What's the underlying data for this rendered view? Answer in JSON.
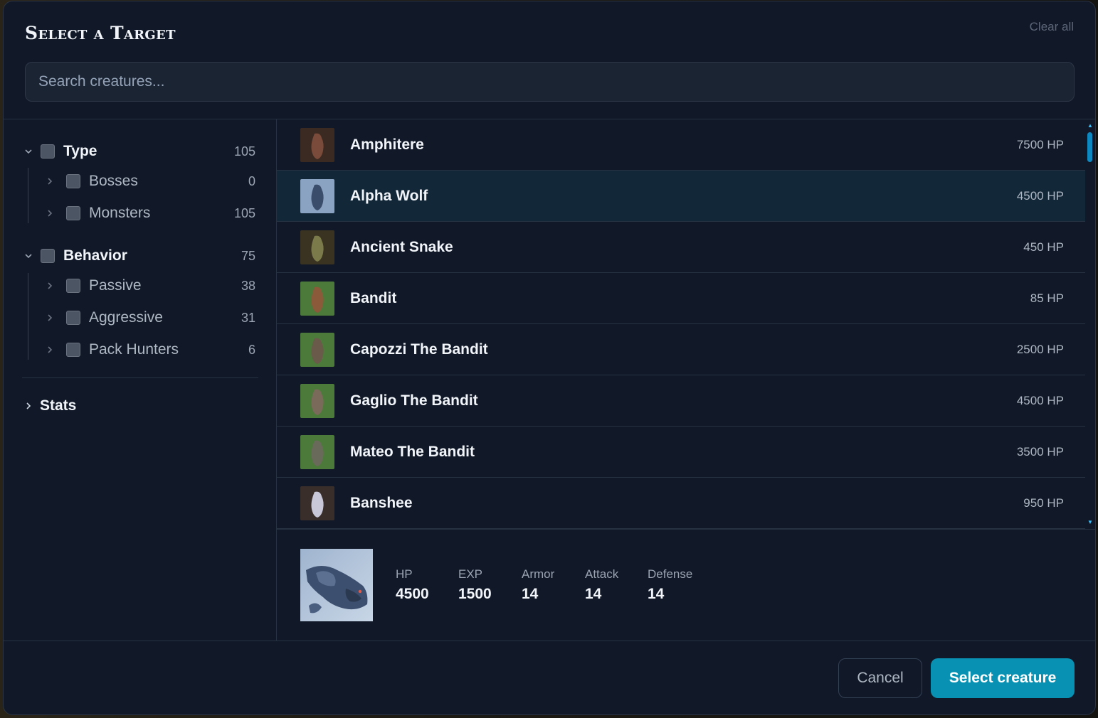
{
  "dialog": {
    "title": "Select a Target",
    "clear_all": "Clear all",
    "search_placeholder": "Search creatures..."
  },
  "filters": {
    "groups": [
      {
        "label": "Type",
        "count": "105",
        "expanded": true,
        "items": [
          {
            "label": "Bosses",
            "count": "0"
          },
          {
            "label": "Monsters",
            "count": "105"
          }
        ]
      },
      {
        "label": "Behavior",
        "count": "75",
        "expanded": true,
        "items": [
          {
            "label": "Passive",
            "count": "38"
          },
          {
            "label": "Aggressive",
            "count": "31"
          },
          {
            "label": "Pack Hunters",
            "count": "6"
          }
        ]
      }
    ],
    "stats_label": "Stats"
  },
  "creatures": [
    {
      "name": "Amphitere",
      "hp": "7500 HP",
      "colors": [
        "#3b2a22",
        "#7a4a3a"
      ]
    },
    {
      "name": "Alpha Wolf",
      "hp": "4500 HP",
      "colors": [
        "#8aa3c2",
        "#3a4d6a"
      ],
      "selected": true
    },
    {
      "name": "Ancient Snake",
      "hp": "450 HP",
      "colors": [
        "#3a3322",
        "#7a7a4a"
      ]
    },
    {
      "name": "Bandit",
      "hp": "85 HP",
      "colors": [
        "#4b7a3a",
        "#8a5a3a"
      ]
    },
    {
      "name": "Capozzi The Bandit",
      "hp": "2500 HP",
      "colors": [
        "#4b7a3a",
        "#6a5a4a"
      ]
    },
    {
      "name": "Gaglio The Bandit",
      "hp": "4500 HP",
      "colors": [
        "#4b7a3a",
        "#7a6a5a"
      ]
    },
    {
      "name": "Mateo The Bandit",
      "hp": "3500 HP",
      "colors": [
        "#4b7a3a",
        "#6a6a5a"
      ]
    },
    {
      "name": "Banshee",
      "hp": "950 HP",
      "colors": [
        "#3a2e2a",
        "#c8c8d8"
      ]
    }
  ],
  "detail": {
    "stats": [
      {
        "label": "HP",
        "value": "4500"
      },
      {
        "label": "EXP",
        "value": "1500"
      },
      {
        "label": "Armor",
        "value": "14"
      },
      {
        "label": "Attack",
        "value": "14"
      },
      {
        "label": "Defense",
        "value": "14"
      }
    ]
  },
  "footer": {
    "cancel_label": "Cancel",
    "select_label": "Select creature"
  },
  "colors": {
    "accent": "#0891b2",
    "background": "#111827",
    "selected_row": "#122738"
  }
}
